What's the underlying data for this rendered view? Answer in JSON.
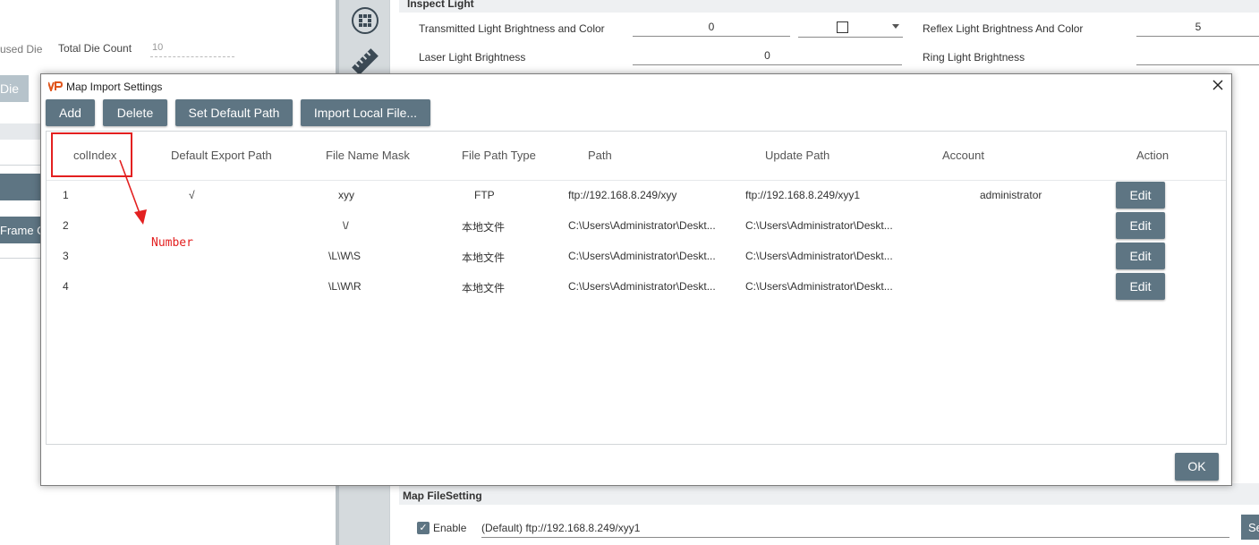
{
  "background": {
    "left_panel": {
      "partial_label": "used Die",
      "total_die_count_label": "Total Die Count",
      "total_die_count_value": "10",
      "die_button_partial": "Die",
      "frame_button_partial": "Frame C"
    },
    "right_panel": {
      "inspect_light_title": "Inspect Light",
      "transmitted_label": "Transmitted Light Brightness and Color",
      "transmitted_value": "0",
      "reflex_label": "Reflex Light Brightness And Color",
      "reflex_value": "5",
      "laser_label": "Laser Light Brightness",
      "laser_value": "0",
      "ring_label": "Ring Light Brightness",
      "map_filesetting_title": "Map FileSetting",
      "enable_label": "Enable",
      "enable_checked": true,
      "file_path_value": "(Default) ftp://192.168.8.249/xyy1",
      "se_button_partial": "Se"
    }
  },
  "dialog": {
    "title": "Map Import Settings",
    "toolbar": {
      "add": "Add",
      "delete": "Delete",
      "set_default_path": "Set Default Path",
      "import_local_file": "Import Local File..."
    },
    "columns": [
      "colIndex",
      "Default Export Path",
      "File Name Mask",
      "File Path Type",
      "Path",
      "Update Path",
      "Account",
      "Action"
    ],
    "rows": [
      {
        "index": "1",
        "default_export": "√",
        "mask": "xyy",
        "type": "FTP",
        "path": "ftp://192.168.8.249/xyy",
        "update_path": "ftp://192.168.8.249/xyy1",
        "account": "administrator",
        "action": "Edit"
      },
      {
        "index": "2",
        "default_export": "",
        "mask": "\\/",
        "type": "本地文件",
        "path": "C:\\Users\\Administrator\\Deskt...",
        "update_path": "C:\\Users\\Administrator\\Deskt...",
        "account": "",
        "action": "Edit"
      },
      {
        "index": "3",
        "default_export": "",
        "mask": "\\L\\W\\S",
        "type": "本地文件",
        "path": "C:\\Users\\Administrator\\Deskt...",
        "update_path": "C:\\Users\\Administrator\\Deskt...",
        "account": "",
        "action": "Edit"
      },
      {
        "index": "4",
        "default_export": "",
        "mask": "\\L\\W\\R",
        "type": "本地文件",
        "path": "C:\\Users\\Administrator\\Deskt...",
        "update_path": "C:\\Users\\Administrator\\Deskt...",
        "account": "",
        "action": "Edit"
      }
    ],
    "annotation": "Number",
    "ok": "OK"
  },
  "colors": {
    "button": "#5e7583",
    "annotation": "#e32020"
  }
}
